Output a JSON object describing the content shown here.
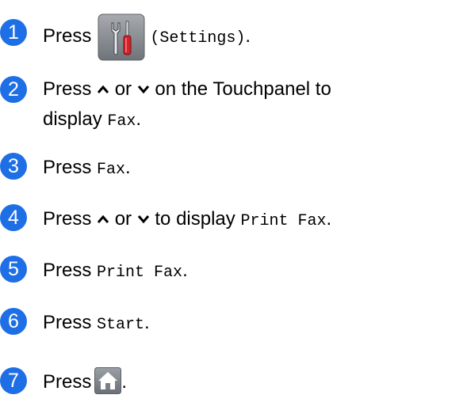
{
  "steps": [
    {
      "number": "1",
      "press": "Press",
      "icon": "settings-icon",
      "mono": "(Settings)",
      "after": "."
    },
    {
      "number": "2",
      "press": "Press",
      "or": "or",
      "rest1": "on the Touchpanel to",
      "display": "display",
      "mono": "Fax",
      "after": "."
    },
    {
      "number": "3",
      "press": "Press",
      "mono": "Fax",
      "after": "."
    },
    {
      "number": "4",
      "press": "Press",
      "or": "or",
      "rest1": "to display",
      "mono": "Print Fax",
      "after": "."
    },
    {
      "number": "5",
      "press": "Press",
      "mono": "Print Fax",
      "after": "."
    },
    {
      "number": "6",
      "press": "Press",
      "mono": "Start",
      "after": "."
    },
    {
      "number": "7",
      "press": "Press",
      "icon": "home-icon",
      "after": "."
    }
  ],
  "colors": {
    "step_circle": "#1e6fe6",
    "icon_bg": "#8a8f94"
  }
}
